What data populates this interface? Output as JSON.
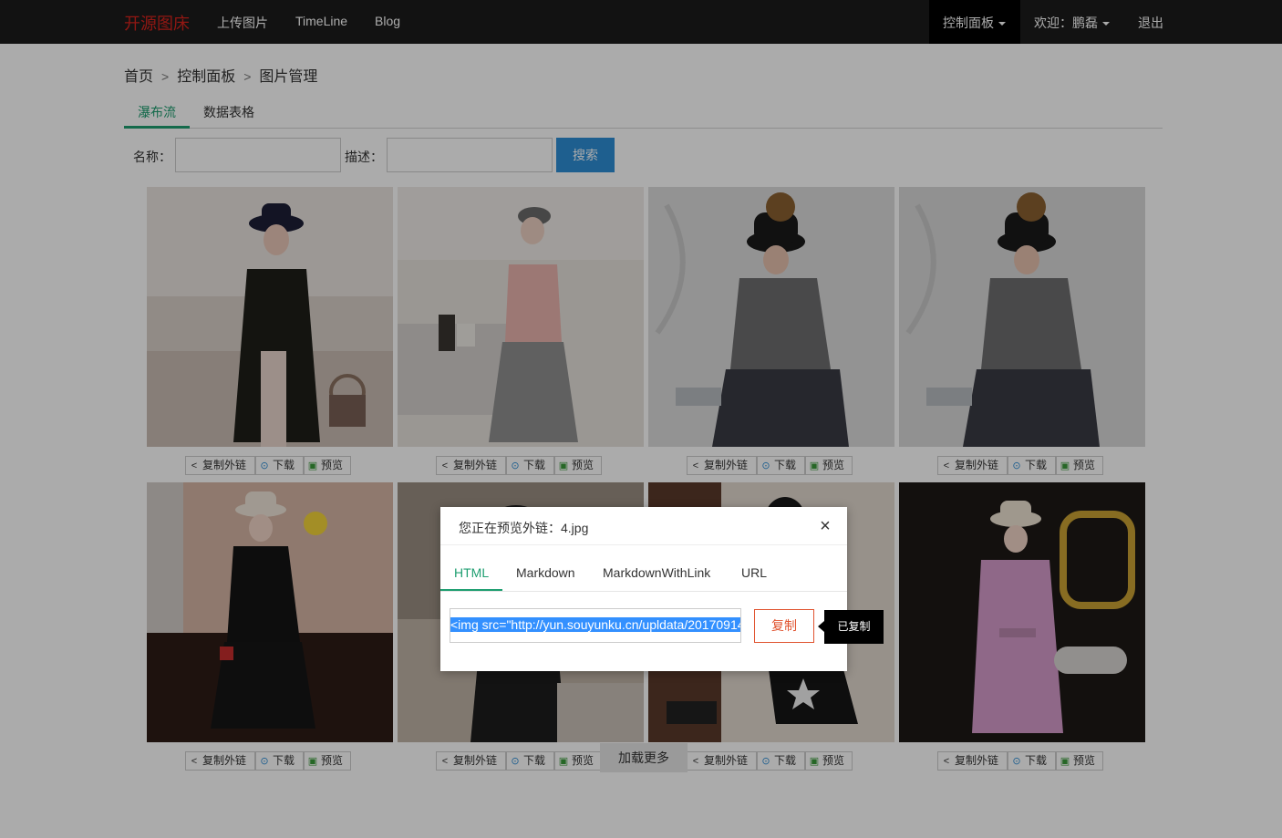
{
  "navbar": {
    "brand": "开源图床",
    "links": [
      "上传图片",
      "TimeLine",
      "Blog"
    ],
    "control_panel": "控制面板",
    "welcome": "欢迎：鹏磊",
    "logout": "退出"
  },
  "breadcrumb": [
    "首页",
    "控制面板",
    "图片管理"
  ],
  "tabs": [
    "瀑布流",
    "数据表格"
  ],
  "search": {
    "name_label": "名称：",
    "desc_label": "描述：",
    "button": "搜索"
  },
  "actions": {
    "copy_link": "复制外链",
    "download": "下载",
    "preview": "预览"
  },
  "load_more": "加载更多",
  "modal": {
    "title": "您正在预览外链：4.jpg",
    "tabs": [
      "HTML",
      "Markdown",
      "MarkdownWithLink",
      "URL"
    ],
    "code": "<img src=\"http://yun.souyunku.cn/upldata/20170914",
    "copy_button": "复制",
    "tooltip": "已复制"
  },
  "colors": {
    "brand": "#d9231c",
    "accent": "#1e9e70",
    "primary": "#2d8ed6",
    "danger": "#e0532f"
  }
}
